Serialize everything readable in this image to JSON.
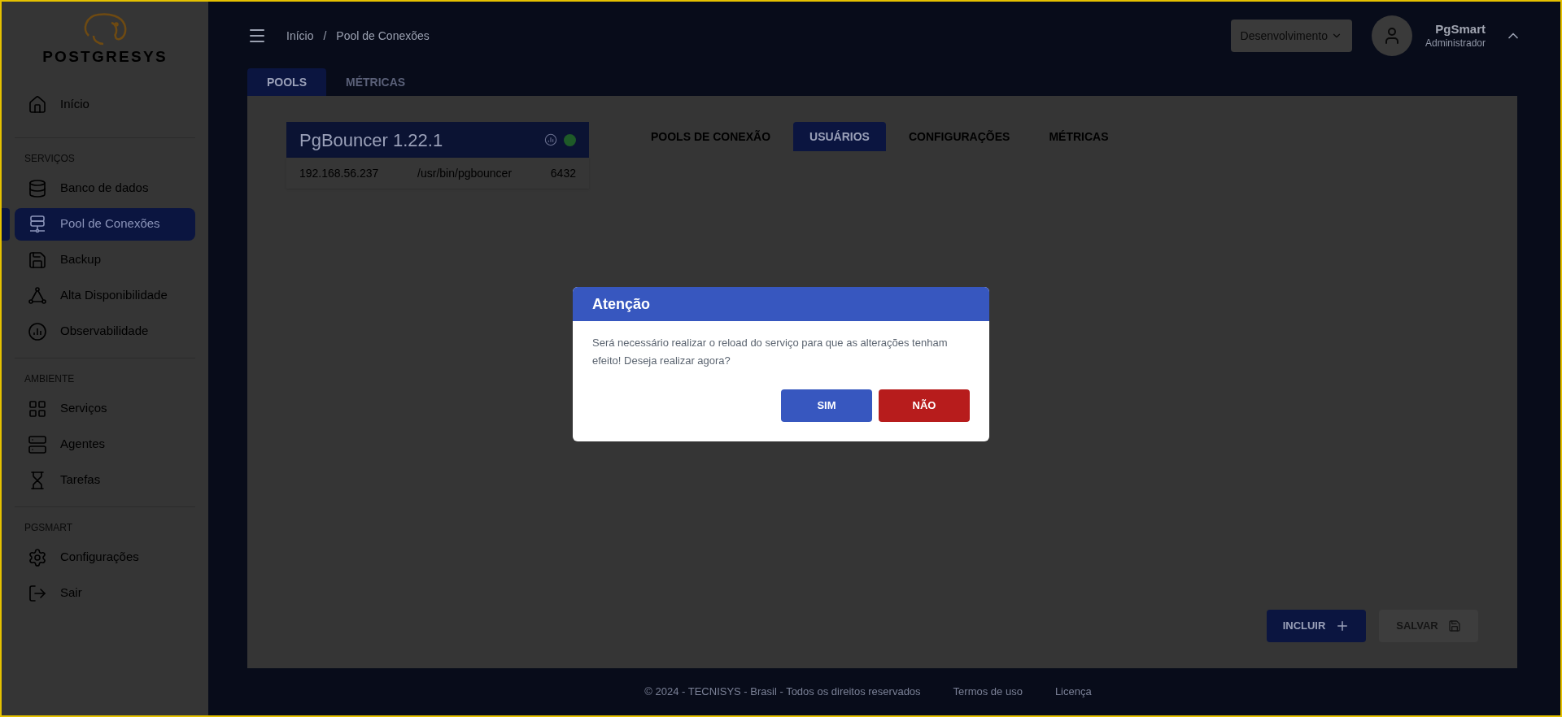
{
  "sidebar": {
    "logo_text": "POSTGRESYS",
    "sections": [
      {
        "items": [
          {
            "label": "Início",
            "selected": false
          }
        ]
      },
      {
        "title": "SERVIÇOS",
        "items": [
          {
            "label": "Banco de dados",
            "selected": false
          },
          {
            "label": "Pool de Conexões",
            "selected": true
          },
          {
            "label": "Backup",
            "selected": false
          },
          {
            "label": "Alta Disponibilidade",
            "selected": false
          },
          {
            "label": "Observabilidade",
            "selected": false
          }
        ]
      },
      {
        "title": "AMBIENTE",
        "items": [
          {
            "label": "Serviços",
            "selected": false
          },
          {
            "label": "Agentes",
            "selected": false
          },
          {
            "label": "Tarefas",
            "selected": false
          }
        ]
      },
      {
        "title": "PGSMART",
        "items": [
          {
            "label": "Configurações",
            "selected": false
          },
          {
            "label": "Sair",
            "selected": false
          }
        ]
      }
    ]
  },
  "header": {
    "breadcrumb": [
      "Início",
      "/",
      "Pool de Conexões"
    ],
    "environment": "Desenvolvimento",
    "user": {
      "name": "PgSmart",
      "role": "Administrador"
    }
  },
  "tabs": [
    {
      "label": "POOLS",
      "selected": true
    },
    {
      "label": "MÉTRICAS",
      "selected": false
    }
  ],
  "pool_card": {
    "title": "PgBouncer 1.22.1",
    "color": "#1e5a28",
    "host": "192.168.56.237",
    "path": "/usr/bin/pgbouncer",
    "port": "6432"
  },
  "subtabs": [
    {
      "label": "POOLS DE CONEXÃO",
      "selected": false
    },
    {
      "label": "USUÁRIOS",
      "selected": true
    },
    {
      "label": "CONFIGURAÇÕES",
      "selected": false
    },
    {
      "label": "MÉTRICAS",
      "selected": false
    }
  ],
  "actions": [
    {
      "label": "INCLUIR",
      "kind": "add",
      "disabled": false
    },
    {
      "label": "SALVAR",
      "kind": "save",
      "disabled": true
    }
  ],
  "footer": [
    "© 2024 - TECNISYS - Brasil - Todos os direitos reservados",
    "Termos de uso",
    "Licença"
  ],
  "dialog": {
    "title": "Atenção",
    "message": "Será necessário realizar o reload do serviço para que as alterações tenham efeito! Deseja realizar agora?",
    "buttons": [
      {
        "label": "SIM",
        "kind": "confirm"
      },
      {
        "label": "NÃO",
        "kind": "cancel"
      }
    ]
  }
}
